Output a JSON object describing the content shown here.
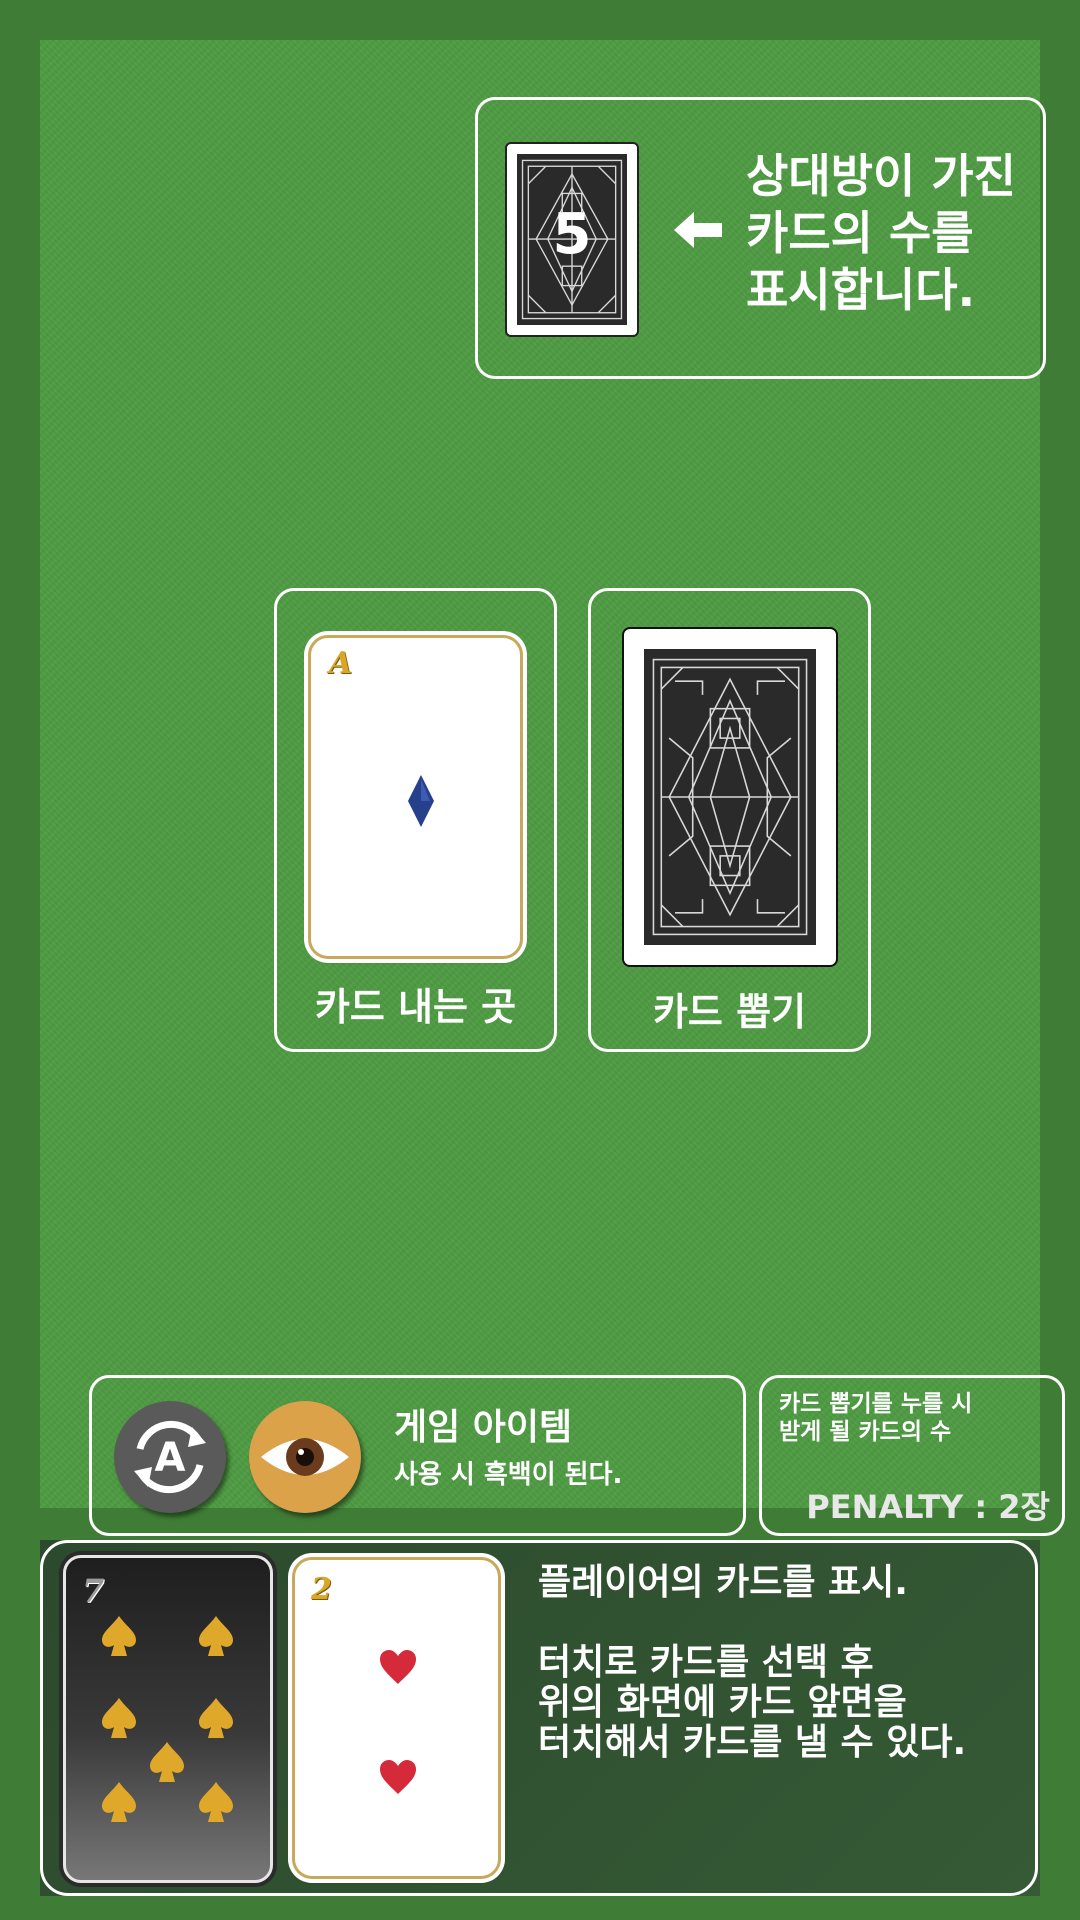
{
  "opponent": {
    "card_count": "5",
    "description": "상대방이 가진\n카드의 수를\n표시합니다."
  },
  "table": {
    "discard": {
      "label": "카드 내는 곳",
      "card": {
        "rank": "A",
        "suit": "diamond",
        "suit_color": "#27408b"
      }
    },
    "draw": {
      "label": "카드 뽑기"
    }
  },
  "items": {
    "title": "게임 아이템",
    "description": "사용 시 흑백이 된다.",
    "buttons": [
      {
        "icon": "swap-a-icon",
        "color": "#5a5a5a"
      },
      {
        "icon": "eye-icon",
        "color": "#dba24a"
      }
    ]
  },
  "penalty": {
    "description": "카드 뽑기를 누를 시\n받게 될 카드의 수",
    "value": "PENALTY : 2장"
  },
  "hand": {
    "description": "플레이어의 카드를 표시.\n\n터치로 카드를 선택 후\n위의 화면에 카드 앞면을\n터치해서 카드를 낼 수 있다.",
    "cards": [
      {
        "rank": "7",
        "suit": "spade",
        "suit_color": "#e0a82a",
        "selected": true
      },
      {
        "rank": "2",
        "suit": "heart",
        "suit_color": "#d42a3a"
      }
    ]
  },
  "colors": {
    "felt": "#4e9a42",
    "border": "#3f7d36",
    "hand_panel": "#2c4a2d"
  }
}
